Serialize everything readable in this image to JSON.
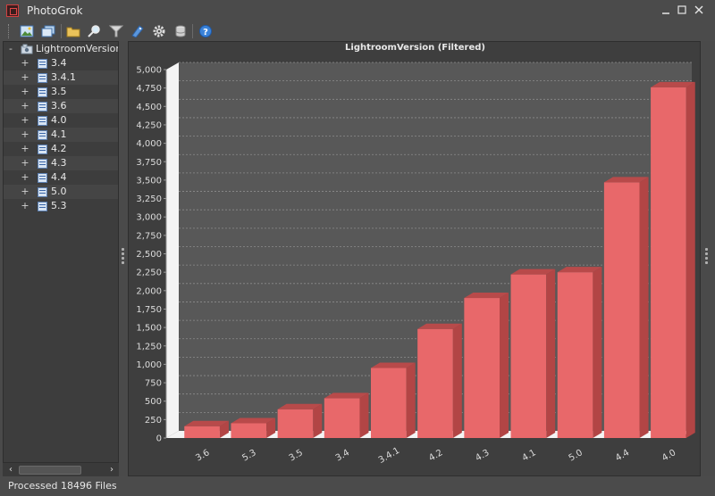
{
  "window": {
    "title": "PhotoGrok",
    "minimize_icon": "minimize-icon",
    "maximize_icon": "maximize-icon",
    "close_icon": "close-icon"
  },
  "toolbar": {
    "icons": [
      "open-image-icon",
      "batch-images-icon",
      "folder-icon",
      "search-icon",
      "filter-icon",
      "tag-icon",
      "gear-icon",
      "database-icon",
      "help-icon"
    ]
  },
  "tree": {
    "root": {
      "label": "LightroomVersion",
      "expander": "-"
    },
    "children": [
      {
        "label": "3.4",
        "expander": "+"
      },
      {
        "label": "3.4.1",
        "expander": "+"
      },
      {
        "label": "3.5",
        "expander": "+"
      },
      {
        "label": "3.6",
        "expander": "+"
      },
      {
        "label": "4.0",
        "expander": "+"
      },
      {
        "label": "4.1",
        "expander": "+"
      },
      {
        "label": "4.2",
        "expander": "+"
      },
      {
        "label": "4.3",
        "expander": "+"
      },
      {
        "label": "4.4",
        "expander": "+"
      },
      {
        "label": "5.0",
        "expander": "+"
      },
      {
        "label": "5.3",
        "expander": "+"
      }
    ]
  },
  "scrollbar": {
    "left_arrow": "‹",
    "right_arrow": "›"
  },
  "status": {
    "text": "Processed 18496 Files"
  },
  "colors": {
    "bar_front": "#e8686a",
    "bar_top": "#b84a4a",
    "bar_side": "#b24545",
    "plot_bg": "#585858"
  },
  "chart_data": {
    "type": "bar",
    "title": "LightroomVersion (Filtered)",
    "xlabel": "",
    "ylabel": "",
    "categories": [
      "3.6",
      "5.3",
      "3.5",
      "3.4",
      "3.4.1",
      "4.2",
      "4.3",
      "4.1",
      "5.0",
      "4.4",
      "4.0"
    ],
    "values": [
      160,
      200,
      390,
      540,
      950,
      1480,
      1900,
      2220,
      2250,
      3470,
      4760
    ],
    "ylim": [
      0,
      5000
    ],
    "yticks": [
      0,
      250,
      500,
      750,
      1000,
      1250,
      1500,
      1750,
      2000,
      2250,
      2500,
      2750,
      3000,
      3250,
      3500,
      3750,
      4000,
      4250,
      4500,
      4750,
      5000
    ],
    "ytick_labels": [
      "0",
      "250",
      "500",
      "750",
      "1,000",
      "1,250",
      "1,500",
      "1,750",
      "2,000",
      "2,250",
      "2,500",
      "2,750",
      "3,000",
      "3,250",
      "3,500",
      "3,750",
      "4,000",
      "4,250",
      "4,500",
      "4,750",
      "5,000"
    ],
    "grid": true,
    "style": "3d"
  }
}
